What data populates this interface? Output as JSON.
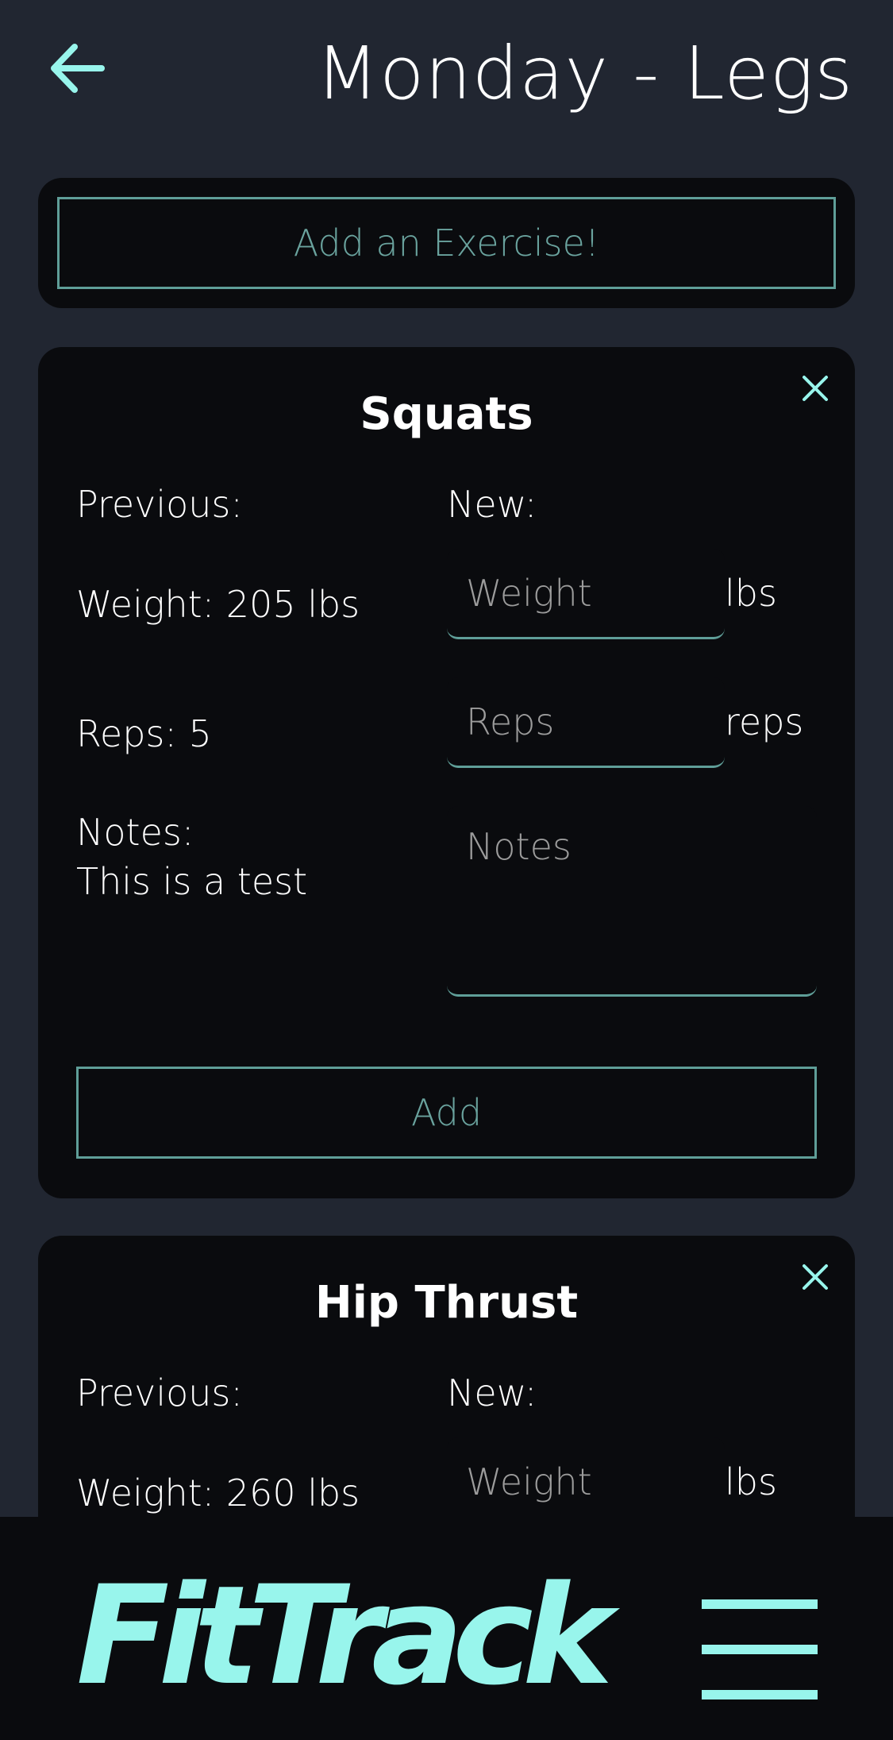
{
  "header": {
    "title": "Monday - Legs",
    "back_icon": "arrow-left-icon"
  },
  "add_exercise": {
    "label": "Add an Exercise!"
  },
  "exercises": [
    {
      "name": "Squats",
      "previous_label": "Previous:",
      "new_label": "New:",
      "previous_weight": "Weight: 205 lbs",
      "previous_reps": "Reps: 5",
      "notes_label": "Notes:",
      "previous_notes": "This is a test",
      "weight_placeholder": "Weight",
      "reps_placeholder": "Reps",
      "notes_placeholder": "Notes",
      "weight_unit": "lbs",
      "reps_unit": "reps",
      "add_label": "Add"
    },
    {
      "name": "Hip Thrust",
      "previous_label": "Previous:",
      "new_label": "New:",
      "previous_weight": "Weight: 260 lbs",
      "weight_placeholder": "Weight",
      "weight_unit": "lbs"
    }
  ],
  "footer": {
    "logo": "FitTrack",
    "menu_icon": "hamburger-menu-icon"
  },
  "colors": {
    "background": "#212631",
    "card": "#0a0b0e",
    "accent": "#98f5ec",
    "border": "#5f9e98",
    "button_text": "#6aa39e"
  }
}
